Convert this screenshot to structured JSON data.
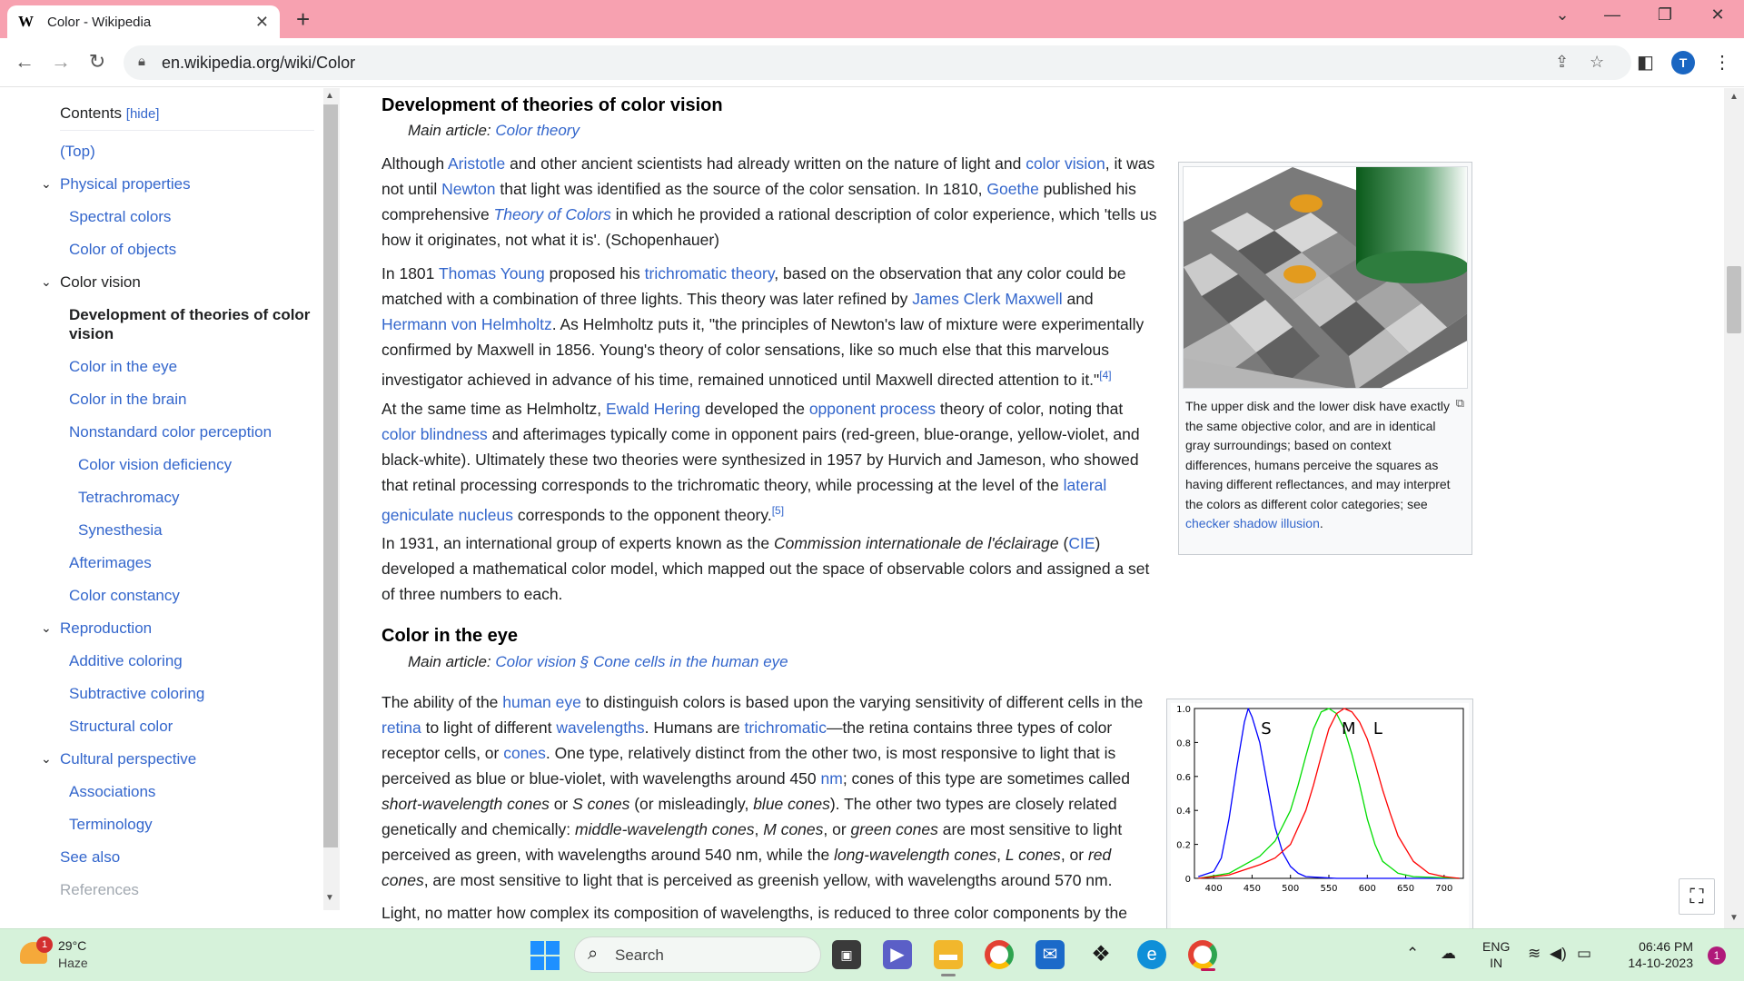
{
  "browser": {
    "tab_title": "Color - Wikipedia",
    "favicon": "W",
    "url": "en.wikipedia.org/wiki/Color",
    "profile_initial": "T"
  },
  "toc": {
    "title": "Contents",
    "hide_label": "[hide]",
    "items": [
      {
        "label": "(Top)"
      },
      {
        "label": "Physical properties"
      },
      {
        "label": "Spectral colors"
      },
      {
        "label": "Color of objects"
      },
      {
        "label": "Color vision"
      },
      {
        "label": "Development of theories of color vision"
      },
      {
        "label": "Color in the eye"
      },
      {
        "label": "Color in the brain"
      },
      {
        "label": "Nonstandard color perception"
      },
      {
        "label": "Color vision deficiency"
      },
      {
        "label": "Tetrachromacy"
      },
      {
        "label": "Synesthesia"
      },
      {
        "label": "Afterimages"
      },
      {
        "label": "Color constancy"
      },
      {
        "label": "Reproduction"
      },
      {
        "label": "Additive coloring"
      },
      {
        "label": "Subtractive coloring"
      },
      {
        "label": "Structural color"
      },
      {
        "label": "Cultural perspective"
      },
      {
        "label": "Associations"
      },
      {
        "label": "Terminology"
      },
      {
        "label": "See also"
      },
      {
        "label": "References"
      }
    ]
  },
  "article": {
    "section1": {
      "heading": "Development of theories of color vision",
      "hatnote_prefix": "Main article:",
      "hatnote_link": "Color theory",
      "p1": {
        "t1": "Although ",
        "l1": "Aristotle",
        "t2": " and other ancient scientists had already written on the nature of light and ",
        "l2": "color vision",
        "t3": ", it was not until ",
        "l3": "Newton",
        "t4": " that light was identified as the source of the color sensation. In 1810, ",
        "l4": "Goethe",
        "t5": " published his comprehensive ",
        "l5": "Theory of Colors",
        "t6": " in which he provided a rational description of color experience, which 'tells us how it originates, not what it is'. (Schopenhauer)"
      },
      "p2": {
        "t1": "In 1801 ",
        "l1": "Thomas Young",
        "t2": " proposed his ",
        "l2": "trichromatic theory",
        "t3": ", based on the observation that any color could be matched with a combination of three lights. This theory was later refined by ",
        "l3": "James Clerk Maxwell",
        "t4": " and ",
        "l4": "Hermann von Helmholtz",
        "t5": ". As Helmholtz puts it, \"the principles of Newton's law of mixture were experimentally confirmed by Maxwell in 1856. Young's theory of color sensations, like so much else that this marvelous investigator achieved in advance of his time, remained unnoticed until Maxwell directed attention to it.\"",
        "ref": "[4]"
      },
      "p3": {
        "t1": "At the same time as Helmholtz, ",
        "l1": "Ewald Hering",
        "t2": " developed the ",
        "l2": "opponent process",
        "t3": " theory of color, noting that ",
        "l3": "color blindness",
        "t4": " and afterimages typically come in opponent pairs (red-green, blue-orange, yellow-violet, and black-white). Ultimately these two theories were synthesized in 1957 by Hurvich and Jameson, who showed that retinal processing corresponds to the trichromatic theory, while processing at the level of the ",
        "l4": "lateral geniculate nucleus",
        "t5": " corresponds to the opponent theory.",
        "ref": "[5]"
      },
      "p4": {
        "t1": "In 1931, an international group of experts known as the ",
        "i1": "Commission internationale de l'éclairage",
        "t2": " (",
        "l1": "CIE",
        "t3": ") developed a mathematical color model, which mapped out the space of observable colors and assigned a set of three numbers to each."
      },
      "figure": {
        "caption": "The upper disk and the lower disk have exactly the same objective color, and are in identical gray surroundings; based on context differences, humans perceive the squares as having different reflectances, and may interpret the colors as different color categories; see ",
        "caption_link": "checker shadow illusion",
        "caption_end": "."
      }
    },
    "section2": {
      "heading": "Color in the eye",
      "hatnote_prefix": "Main article:",
      "hatnote_link": "Color vision § Cone cells in the human eye",
      "p1": {
        "t1": "The ability of the ",
        "l1": "human eye",
        "t2": " to distinguish colors is based upon the varying sensitivity of different cells in the ",
        "l2": "retina",
        "t3": " to light of different ",
        "l3": "wavelengths",
        "t4": ". Humans are ",
        "l4": "trichromatic",
        "t5": "—the retina contains three types of color receptor cells, or ",
        "l5": "cones",
        "t6": ". One type, relatively distinct from the other two, is most responsive to light that is perceived as blue or blue-violet, with wavelengths around 450 ",
        "l6": "nm",
        "t7": "; cones of this type are sometimes called ",
        "i1": "short-wavelength cones",
        "t8": " or ",
        "i2": "S cones",
        "t9": " (or misleadingly, ",
        "i3": "blue cones",
        "t10": "). The other two types are closely related genetically and chemically: ",
        "i4": "middle-wavelength cones",
        "t11": ", ",
        "i5": "M cones",
        "t12": ", or ",
        "i6": "green cones",
        "t13": " are most sensitive to light perceived as green, with wavelengths around 540 nm, while the ",
        "i7": "long-wavelength cones",
        "t14": ", ",
        "i8": "L cones",
        "t15": ", or ",
        "i9": "red cones",
        "t16": ", are most sensitive to light that is perceived as greenish yellow, with wavelengths around 570 nm."
      },
      "p2_partial": "Light, no matter how complex its composition of wavelengths, is reduced to three color components by the"
    }
  },
  "chart_data": {
    "type": "line",
    "title": "",
    "xlabel": "",
    "ylabel": "",
    "xlim": [
      375,
      725
    ],
    "ylim": [
      0,
      1.0
    ],
    "x_ticks": [
      "400",
      "450",
      "500",
      "550",
      "600",
      "650",
      "700"
    ],
    "y_ticks": [
      "0",
      "0.2",
      "0.4",
      "0.6",
      "0.8",
      "1.0"
    ],
    "series": [
      {
        "name": "S",
        "color": "#0000ff",
        "x": [
          380,
          400,
          410,
          420,
          430,
          440,
          445,
          450,
          460,
          470,
          480,
          490,
          500,
          510,
          520,
          540,
          560,
          600,
          720
        ],
        "y": [
          0.01,
          0.04,
          0.12,
          0.35,
          0.65,
          0.92,
          1.0,
          0.95,
          0.8,
          0.55,
          0.3,
          0.15,
          0.07,
          0.03,
          0.01,
          0.005,
          0,
          0,
          0
        ]
      },
      {
        "name": "M",
        "color": "#00dd00",
        "x": [
          380,
          420,
          440,
          460,
          480,
          500,
          510,
          520,
          530,
          540,
          550,
          560,
          570,
          580,
          590,
          600,
          610,
          620,
          640,
          660,
          720
        ],
        "y": [
          0.0,
          0.03,
          0.08,
          0.13,
          0.22,
          0.4,
          0.55,
          0.72,
          0.88,
          0.98,
          1.0,
          0.97,
          0.88,
          0.73,
          0.55,
          0.35,
          0.2,
          0.1,
          0.03,
          0.01,
          0
        ]
      },
      {
        "name": "L",
        "color": "#ff0000",
        "x": [
          380,
          420,
          440,
          460,
          480,
          500,
          520,
          530,
          540,
          550,
          560,
          570,
          580,
          590,
          600,
          610,
          620,
          630,
          640,
          660,
          680,
          700,
          720
        ],
        "y": [
          0.0,
          0.02,
          0.05,
          0.08,
          0.12,
          0.2,
          0.4,
          0.55,
          0.72,
          0.88,
          0.97,
          1.0,
          0.98,
          0.92,
          0.82,
          0.68,
          0.52,
          0.38,
          0.25,
          0.1,
          0.03,
          0.01,
          0
        ]
      }
    ]
  },
  "taskbar": {
    "temperature": "29°C",
    "condition": "Haze",
    "weather_badge": "1",
    "search_placeholder": "Search",
    "lang1": "ENG",
    "lang2": "IN",
    "time": "06:46 PM",
    "date": "14-10-2023",
    "notification_count": "1"
  }
}
